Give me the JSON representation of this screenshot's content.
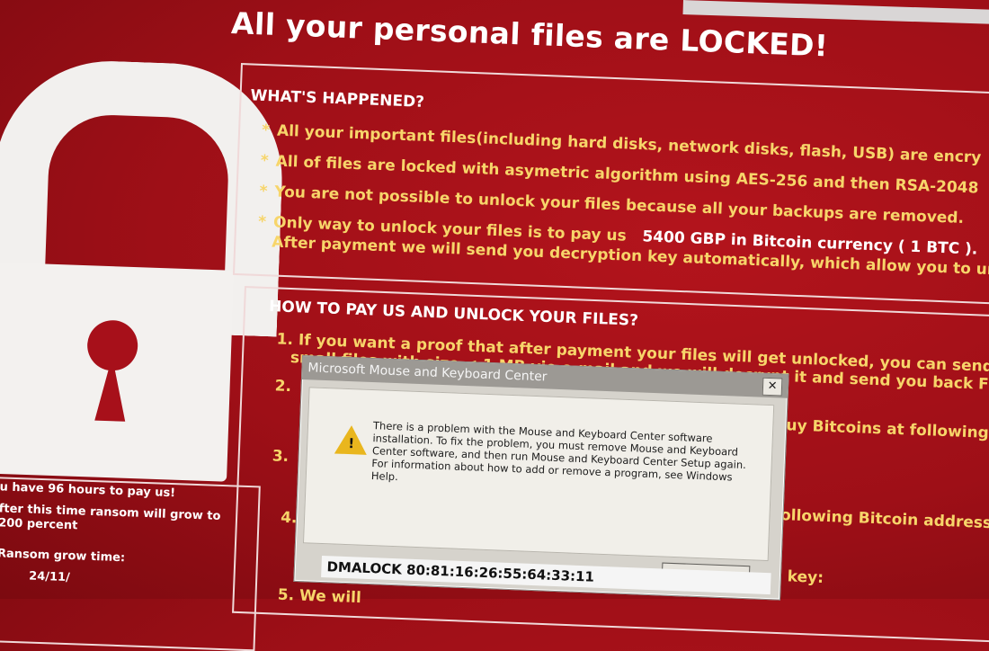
{
  "title": "All your personal files are LOCKED!",
  "whats_happened": {
    "heading": "WHAT'S HAPPENED?",
    "bullets": [
      "All your important files(including hard disks, network disks, flash, USB) are encry",
      "All of files are locked with asymetric algorithm using AES-256 and then RSA-2048",
      "You are not possible to unlock your files because all your backups are removed.",
      "Only way to unlock your files is to pay us"
    ],
    "amount": "5400 GBP in Bitcoin currency ( 1 BTC ).",
    "after_payment": "After payment we will send you decryption key automatically, which allow you to un"
  },
  "how_to_pay": {
    "heading": "HOW TO PAY US AND UNLOCK YOUR FILES?",
    "step1_line1": "1. If you want a proof that after payment your files will get unlocked, you can send us y",
    "step1_line2": "small files with size < 1 MB vie e-mail and we will decrypt it and send you back FOR F",
    "step2_num": "2.",
    "step2_tail": "uy Bitcoins at following",
    "step3_num": "3.",
    "step4_num": "4.",
    "step4_tail": "following Bitcoin address",
    "key_tail": "on key:",
    "step5": "5. We will"
  },
  "left_panel": {
    "line1": "u have 96 hours to pay us!",
    "line2": "fter this time ransom will grow to",
    "line3": "200 percent",
    "line4": "Ransom grow time:",
    "line5": "24/11/"
  },
  "dialog": {
    "title": "Microsoft Mouse and Keyboard Center",
    "close": "✕",
    "warning_icon": "warning-icon",
    "message": "There is a problem with the Mouse and Keyboard Center software installation. To fix the problem, you must remove Mouse and Keyboard Center software, and then run Mouse and Keyboard Center Setup again. For information about how to add or remove a program, see Windows Help."
  },
  "key_code": "DMALOCK 80:81:16:26:55:64:33:11",
  "colors": {
    "background": "#a7101a",
    "text_yellow": "#f7d56a",
    "text_white": "#ffffff"
  }
}
